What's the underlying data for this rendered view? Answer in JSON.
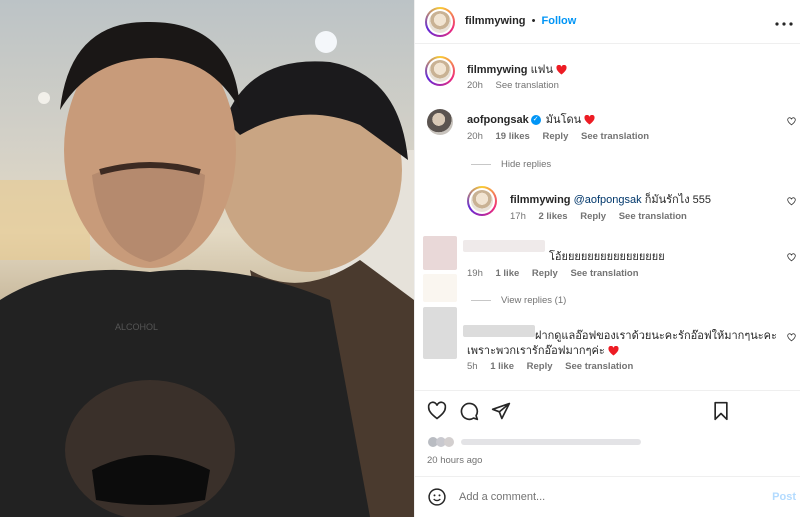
{
  "post": {
    "username": "filmmywing",
    "separator": "•",
    "follow_label": "Follow",
    "more_label": "•••"
  },
  "caption": {
    "username": "filmmywing",
    "text": "แฟน",
    "time": "20h",
    "see_translation": "See translation"
  },
  "comments": [
    {
      "username": "aofpongsak",
      "verified": true,
      "text": "มันโดน",
      "time": "20h",
      "likes": "19 likes",
      "reply": "Reply",
      "see_translation": "See translation",
      "hide_replies": "Hide replies",
      "replies": [
        {
          "username": "filmmywing",
          "mention": "@aofpongsak",
          "text": "ก็มันรักไง 555",
          "time": "17h",
          "likes": "2 likes",
          "reply": "Reply",
          "see_translation": "See translation"
        }
      ]
    },
    {
      "text": "โอ้ยยยยยยยยยยยยยยยย",
      "time": "19h",
      "likes": "1 like",
      "reply": "Reply",
      "see_translation": "See translation",
      "view_replies": "View replies (1)"
    },
    {
      "text_line1": "ฝากดูแลอ๊อฟของเราด้วยนะคะรักอ๊อฟให้มากๆนะคะ",
      "text_line2": "เพราะพวกเรารักอ๊อฟมากๆค่ะ",
      "time": "5h",
      "likes": "1 like",
      "reply": "Reply",
      "see_translation": "See translation"
    }
  ],
  "posted_time": "20 hours ago",
  "add_comment": {
    "placeholder": "Add a comment...",
    "post_label": "Post"
  },
  "icons": [
    "heart-icon",
    "comment-icon",
    "share-icon",
    "bookmark-icon",
    "emoji-icon",
    "more-icon"
  ],
  "colors": {
    "accent": "#0095f6",
    "heart": "#ed1c24",
    "muted": "#737373"
  }
}
